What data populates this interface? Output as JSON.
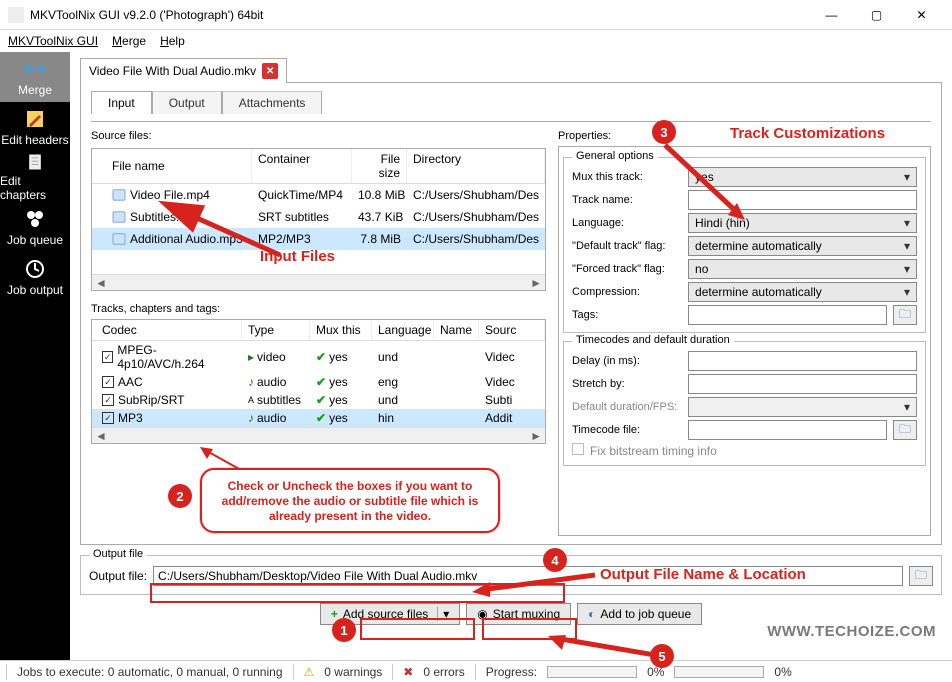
{
  "window": {
    "title": "MKVToolNix GUI v9.2.0 ('Photograph') 64bit",
    "min": "—",
    "max": "▢",
    "close": "✕"
  },
  "menu": {
    "items": [
      "MKVToolNix GUI",
      "Merge",
      "Help"
    ]
  },
  "sidebar": {
    "items": [
      {
        "label": "Merge"
      },
      {
        "label": "Edit headers"
      },
      {
        "label": "Edit chapters"
      },
      {
        "label": "Job queue"
      },
      {
        "label": "Job output"
      }
    ]
  },
  "filetab": {
    "name": "Video File With Dual Audio.mkv"
  },
  "tabs": {
    "input": "Input",
    "output": "Output",
    "attachments": "Attachments"
  },
  "sourceFiles": {
    "label": "Source files:",
    "headers": {
      "fn": "File name",
      "ct": "Container",
      "fs": "File size",
      "dir": "Directory"
    },
    "rows": [
      {
        "fn": "Video File.mp4",
        "ct": "QuickTime/MP4",
        "fs": "10.8 MiB",
        "dir": "C:/Users/Shubham/Des"
      },
      {
        "fn": "Subtitles.srt",
        "ct": "SRT subtitles",
        "fs": "43.7 KiB",
        "dir": "C:/Users/Shubham/Des"
      },
      {
        "fn": "Additional Audio.mp3",
        "ct": "MP2/MP3",
        "fs": "7.8 MiB",
        "dir": "C:/Users/Shubham/Des"
      }
    ]
  },
  "tracks": {
    "label": "Tracks, chapters and tags:",
    "headers": {
      "cd": "Codec",
      "tp": "Type",
      "mx": "Mux this",
      "lg": "Language",
      "nm": "Name",
      "sr": "Sourc"
    },
    "rows": [
      {
        "cd": "MPEG-4p10/AVC/h.264",
        "tp": "video",
        "mx": "yes",
        "lg": "und",
        "nm": "",
        "sr": "Videc"
      },
      {
        "cd": "AAC",
        "tp": "audio",
        "mx": "yes",
        "lg": "eng",
        "nm": "",
        "sr": "Videc"
      },
      {
        "cd": "SubRip/SRT",
        "tp": "subtitles",
        "mx": "yes",
        "lg": "und",
        "nm": "",
        "sr": "Subti"
      },
      {
        "cd": "MP3",
        "tp": "audio",
        "mx": "yes",
        "lg": "hin",
        "nm": "",
        "sr": "Addit"
      }
    ]
  },
  "properties": {
    "label": "Properties:",
    "general": {
      "legend": "General options",
      "mux_label": "Mux this track:",
      "mux_value": "yes",
      "trackname_label": "Track name:",
      "trackname_value": "",
      "language_label": "Language:",
      "language_value": "Hindi (hin)",
      "default_label": "\"Default track\" flag:",
      "default_value": "determine automatically",
      "forced_label": "\"Forced track\" flag:",
      "forced_value": "no",
      "compression_label": "Compression:",
      "compression_value": "determine automatically",
      "tags_label": "Tags:",
      "tags_value": ""
    },
    "timecodes": {
      "legend": "Timecodes and default duration",
      "delay_label": "Delay (in ms):",
      "delay_value": "",
      "stretch_label": "Stretch by:",
      "stretch_value": "",
      "fps_label": "Default duration/FPS:",
      "fps_value": "",
      "tcfile_label": "Timecode file:",
      "tcfile_value": "",
      "fix_label": "Fix bitstream timing info"
    }
  },
  "output": {
    "legend": "Output file",
    "label": "Output file:",
    "value": "C:/Users/Shubham/Desktop/Video File With Dual Audio.mkv"
  },
  "buttons": {
    "add": "Add source files",
    "start": "Start muxing",
    "queue": "Add to job queue"
  },
  "status": {
    "jobs": "Jobs to execute:  0 automatic, 0 manual, 0 running",
    "warnings": "0 warnings",
    "errors": "0 errors",
    "progress_label": "Progress:",
    "p1": "0%",
    "p2": "0%"
  },
  "annotations": {
    "input_files": "Input Files",
    "track_custom": "Track Customizations",
    "output_name": "Output File Name & Location",
    "callout": "Check or Uncheck the boxes if you want to add/remove the audio or subtitle file which is already present in the video.",
    "watermark": "WWW.TECHOIZE.COM"
  }
}
